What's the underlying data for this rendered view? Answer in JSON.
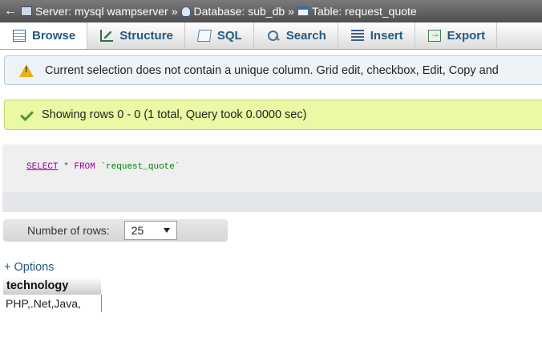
{
  "breadcrumb": {
    "back": "←",
    "server": "Server: mysql wampserver",
    "sep1": "»",
    "database": "Database: sub_db",
    "sep2": "»",
    "table": "Table: request_quote"
  },
  "tabs": [
    {
      "label": "Browse",
      "icon": "browse-icon",
      "active": true
    },
    {
      "label": "Structure",
      "icon": "structure-icon"
    },
    {
      "label": "SQL",
      "icon": "sql-icon"
    },
    {
      "label": "Search",
      "icon": "search-icon"
    },
    {
      "label": "Insert",
      "icon": "insert-icon"
    },
    {
      "label": "Export",
      "icon": "export-icon"
    }
  ],
  "notice": {
    "text": "Current selection does not contain a unique column. Grid edit, checkbox, Edit, Copy and"
  },
  "success": {
    "text": "Showing rows 0 - 0 (1 total, Query took 0.0000 sec)"
  },
  "sql": {
    "select": "SELECT",
    "star": "*",
    "from": "FROM",
    "table": "`request_quote`"
  },
  "rows": {
    "label": "Number of rows:",
    "value": "25"
  },
  "options": {
    "label": "+ Options"
  },
  "result": {
    "columns": [
      "technology"
    ],
    "rows": [
      [
        "PHP,.Net,Java,"
      ]
    ]
  },
  "colors": {
    "accent": "#235a81",
    "success_bg": "#ebf8a4",
    "notice_bg": "#eef3f8"
  }
}
